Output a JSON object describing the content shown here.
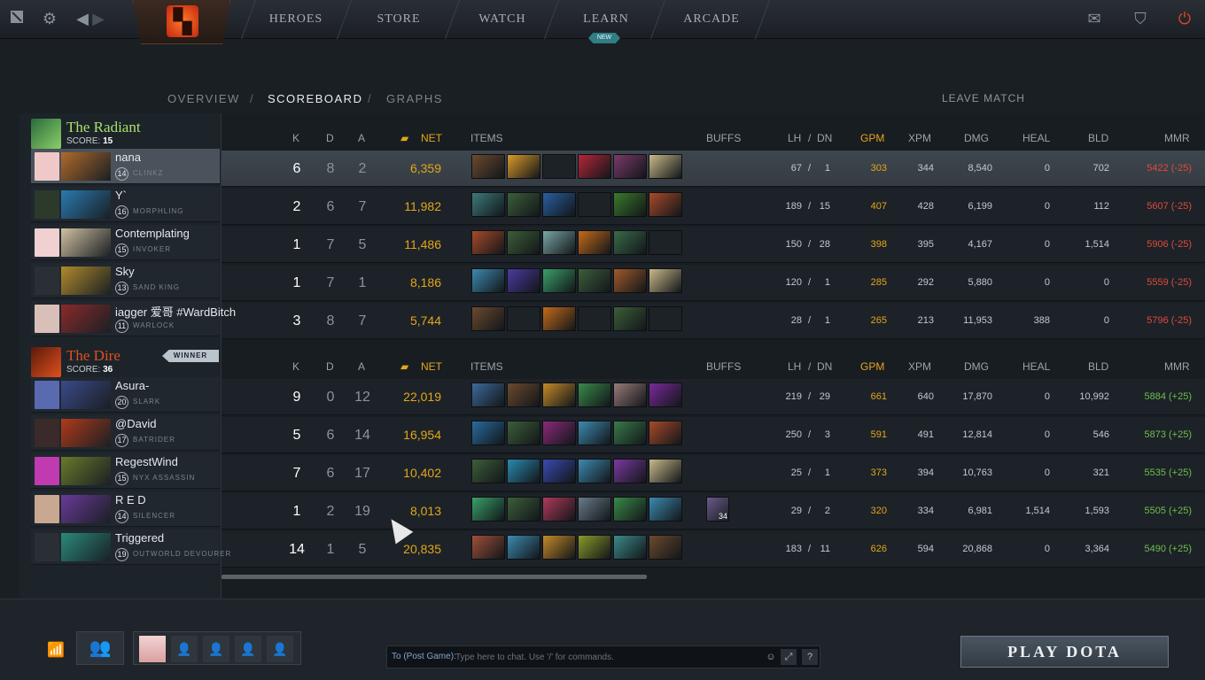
{
  "topbar": {
    "nav": [
      "HEROES",
      "STORE",
      "WATCH",
      "LEARN",
      "ARCADE"
    ],
    "new_badge": "NEW",
    "icons": {
      "dota": "dota-icon",
      "settings": "gear-icon",
      "back": "back-arrow-icon",
      "forward": "forward-arrow-icon",
      "mail": "mail-icon",
      "rank": "rank-icon",
      "power": "power-icon"
    }
  },
  "subnav": {
    "overview": "OVERVIEW",
    "sep1": "/",
    "scoreboard": "SCOREBOARD",
    "sep2": "/",
    "graphs": "GRAPHS",
    "leave": "LEAVE MATCH"
  },
  "columns": {
    "k": "K",
    "d": "D",
    "a": "A",
    "net": "NET",
    "items": "ITEMS",
    "buffs": "BUFFS",
    "lh": "LH",
    "slash": "/",
    "dn": "DN",
    "gpm": "GPM",
    "xpm": "XPM",
    "dmg": "DMG",
    "heal": "HEAL",
    "bld": "BLD",
    "mmr": "MMR"
  },
  "radiant": {
    "name": "The Radiant",
    "score_label": "SCORE:",
    "score": "15",
    "players": [
      {
        "name": "nana",
        "level": "14",
        "hero": "CLINKZ",
        "k": "6",
        "d": "8",
        "a": "2",
        "net": "6,359",
        "lh": "67",
        "dn": "1",
        "gpm": "303",
        "xpm": "344",
        "dmg": "8,540",
        "heal": "0",
        "bld": "702",
        "mmr": "5422 (-25)",
        "items": [
          "#6b4a2e",
          "#d99a2a",
          "empty",
          "#b5263a",
          "#7a3a6a",
          "#c9b98a"
        ]
      },
      {
        "name": "Y`",
        "level": "16",
        "hero": "MORPHLING",
        "k": "2",
        "d": "6",
        "a": "7",
        "net": "11,982",
        "lh": "189",
        "dn": "15",
        "gpm": "407",
        "xpm": "428",
        "dmg": "6,199",
        "heal": "0",
        "bld": "112",
        "mmr": "5607 (-25)",
        "items": [
          "#3d7a7a",
          "#3d5e3a",
          "#2a5ea0",
          "empty",
          "#3a7a2a",
          "#a84a2a"
        ]
      },
      {
        "name": "Contemplating",
        "level": "15",
        "hero": "INVOKER",
        "k": "1",
        "d": "7",
        "a": "5",
        "net": "11,486",
        "lh": "150",
        "dn": "28",
        "gpm": "398",
        "xpm": "395",
        "dmg": "4,167",
        "heal": "0",
        "bld": "1,514",
        "mmr": "5906 (-25)",
        "items": [
          "#a84a2a",
          "#3d5e3a",
          "#7aa6a6",
          "#c46a1a",
          "#3a6a4a",
          "empty"
        ]
      },
      {
        "name": "Sky",
        "level": "13",
        "hero": "SAND KING",
        "k": "1",
        "d": "7",
        "a": "1",
        "net": "8,186",
        "lh": "120",
        "dn": "1",
        "gpm": "285",
        "xpm": "292",
        "dmg": "5,880",
        "heal": "0",
        "bld": "0",
        "mmr": "5559 (-25)",
        "items": [
          "#3d8ab0",
          "#4a3aa0",
          "#3aa06a",
          "#3d5e3a",
          "#a05a2a",
          "#c9b98a"
        ]
      },
      {
        "name": "iagger 爱哥 #WardBitch",
        "level": "11",
        "hero": "WARLOCK",
        "k": "3",
        "d": "8",
        "a": "7",
        "net": "5,744",
        "lh": "28",
        "dn": "1",
        "gpm": "265",
        "xpm": "213",
        "dmg": "11,953",
        "heal": "388",
        "bld": "0",
        "mmr": "5796 (-25)",
        "items": [
          "#6b4a2e",
          "empty",
          "#c46a1a",
          "empty",
          "#3d5e3a",
          "empty"
        ]
      }
    ]
  },
  "dire": {
    "name": "The Dire",
    "score_label": "SCORE:",
    "score": "36",
    "winner": "WINNER",
    "players": [
      {
        "name": "Asura-",
        "level": "20",
        "hero": "SLARK",
        "k": "9",
        "d": "0",
        "a": "12",
        "net": "22,019",
        "lh": "219",
        "dn": "29",
        "gpm": "661",
        "xpm": "640",
        "dmg": "17,870",
        "heal": "0",
        "bld": "10,992",
        "mmr": "5884 (+25)",
        "items": [
          "#3d6a9a",
          "#6b4a2e",
          "#c48a2a",
          "#3a8a4a",
          "#9a7a7a",
          "#7a2a9a"
        ],
        "buff": ""
      },
      {
        "name": "@David",
        "level": "17",
        "hero": "BATRIDER",
        "k": "5",
        "d": "6",
        "a": "14",
        "net": "16,954",
        "lh": "250",
        "dn": "3",
        "gpm": "591",
        "xpm": "491",
        "dmg": "12,814",
        "heal": "0",
        "bld": "546",
        "mmr": "5873 (+25)",
        "items": [
          "#2a6aa0",
          "#3d5e3a",
          "#8a2a7a",
          "#3d8ab0",
          "#3a7a4a",
          "#a84a2a"
        ]
      },
      {
        "name": "RegestWind",
        "level": "15",
        "hero": "NYX ASSASSIN",
        "k": "7",
        "d": "6",
        "a": "17",
        "net": "10,402",
        "lh": "25",
        "dn": "1",
        "gpm": "373",
        "xpm": "394",
        "dmg": "10,763",
        "heal": "0",
        "bld": "321",
        "mmr": "5535 (+25)",
        "items": [
          "#3d5e3a",
          "#2a8ab0",
          "#3a4ab0",
          "#3d8ab0",
          "#7a3aa0",
          "#c9b98a"
        ]
      },
      {
        "name": "R E D",
        "level": "14",
        "hero": "SILENCER",
        "k": "1",
        "d": "2",
        "a": "19",
        "net": "8,013",
        "lh": "29",
        "dn": "2",
        "gpm": "320",
        "xpm": "334",
        "dmg": "6,981",
        "heal": "1,514",
        "bld": "1,593",
        "mmr": "5505 (+25)",
        "items": [
          "#3aa06a",
          "#3d5e3a",
          "#b03a5a",
          "#6a7a8a",
          "#3a8a4a",
          "#3d8ab0"
        ],
        "buff_count": "34"
      },
      {
        "name": "Triggered",
        "level": "19",
        "hero": "OUTWORLD DEVOURER",
        "k": "14",
        "d": "1",
        "a": "5",
        "net": "20,835",
        "lh": "183",
        "dn": "11",
        "gpm": "626",
        "xpm": "594",
        "dmg": "20,868",
        "heal": "0",
        "bld": "3,364",
        "mmr": "5490 (+25)",
        "items": [
          "#a0503a",
          "#3d8ab0",
          "#c48a2a",
          "#8a9a2a",
          "#3d8a8a",
          "#6b4a2e"
        ]
      }
    ]
  },
  "bottom": {
    "chat_label": "To (Post Game):",
    "chat_placeholder": "Type here to chat. Use '/' for commands.",
    "chat_help": "?",
    "play": "PLAY DOTA"
  }
}
